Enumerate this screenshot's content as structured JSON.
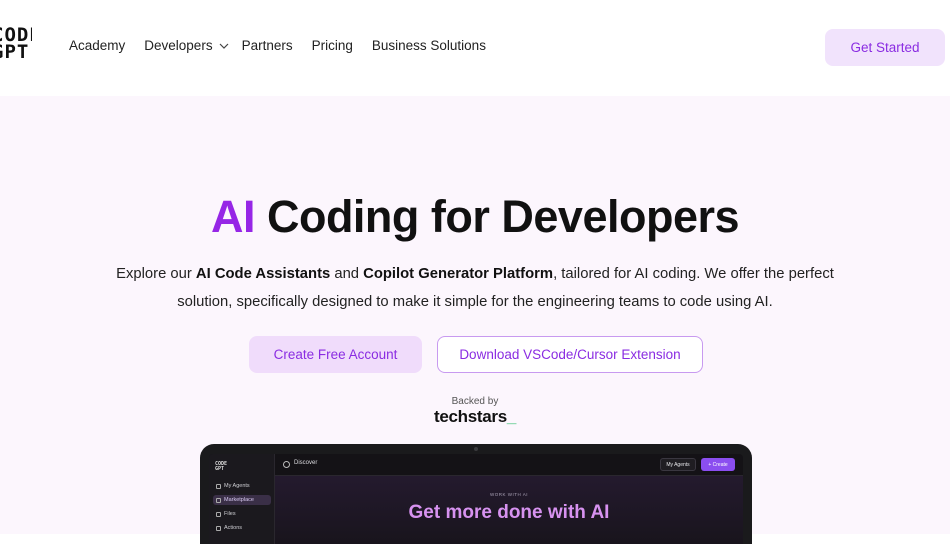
{
  "brand": {
    "logo_line1": "CODE",
    "logo_line2": "GPT"
  },
  "nav": {
    "items": [
      {
        "label": "Academy"
      },
      {
        "label": "Developers"
      },
      {
        "label": "Partners"
      },
      {
        "label": "Pricing"
      },
      {
        "label": "Business Solutions"
      }
    ],
    "cta_label": "Get Started"
  },
  "hero": {
    "title_accent": "AI",
    "title_rest": " Coding for Developers",
    "subtitle_part1": "Explore our ",
    "subtitle_bold1": "AI Code Assistants",
    "subtitle_part2": " and ",
    "subtitle_bold2": "Copilot Generator Platform",
    "subtitle_part3": ", tailored for AI coding. We offer the perfect solution, specifically designed to make it simple for the engineering teams to code using AI.",
    "primary_cta": "Create Free Account",
    "secondary_cta": "Download VSCode/Cursor Extension",
    "backed_by": "Backed by",
    "backer_name": "techstars",
    "backer_suffix": "_"
  },
  "mockup": {
    "topbar_title": "Discover",
    "my_agents_label": "My Agents",
    "create_label": "+ Create",
    "sidebar": [
      {
        "label": "My Agents",
        "active": false
      },
      {
        "label": "Marketplace",
        "active": true
      },
      {
        "label": "Files",
        "active": false
      },
      {
        "label": "Actions",
        "active": false
      }
    ],
    "eyebrow": "WORK WITH AI",
    "heading": "Get more done with AI"
  },
  "colors": {
    "accent": "#9626e6",
    "button_bg": "#f1e3fc",
    "hero_bg": "#fcf6fd",
    "mockup_heading": "#d792f0"
  }
}
